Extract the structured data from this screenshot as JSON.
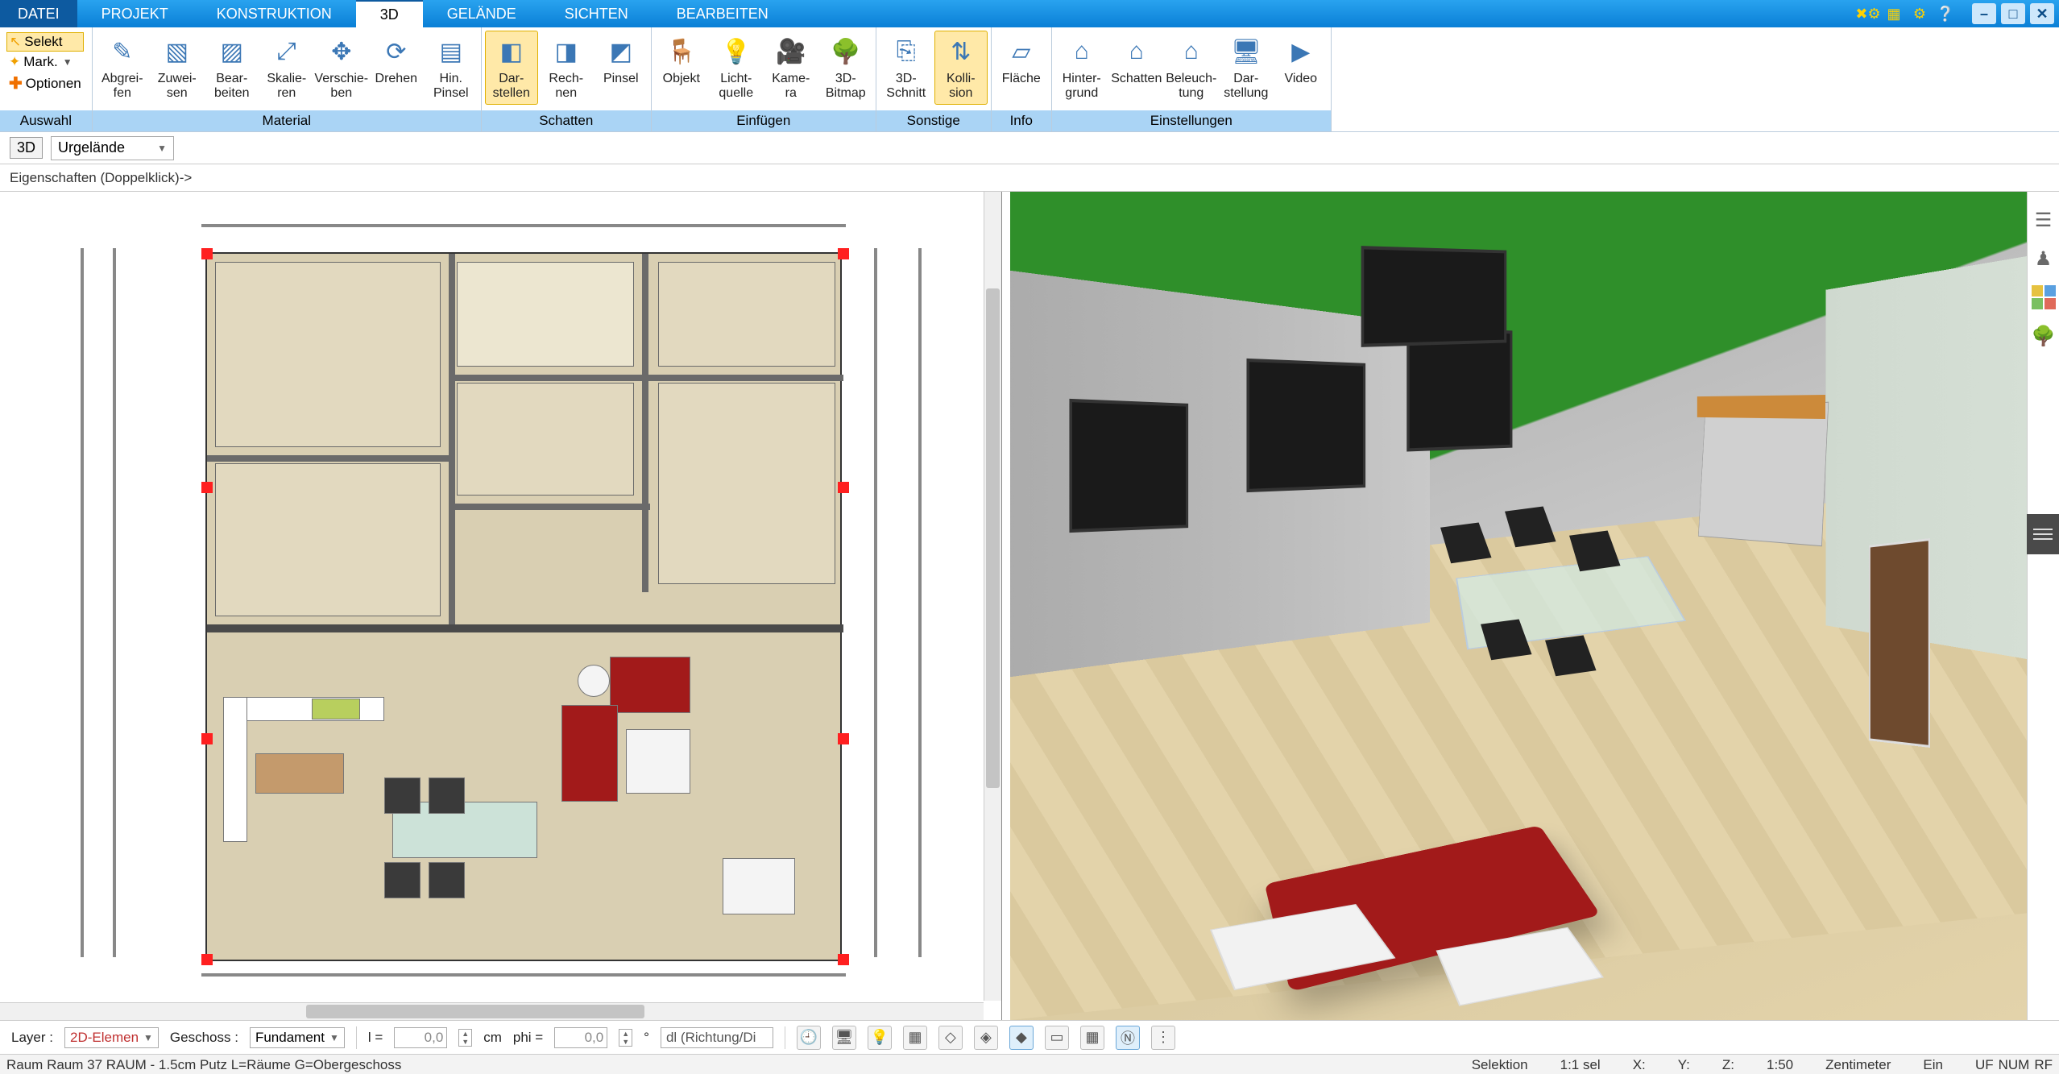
{
  "tabs": {
    "file": "DATEI",
    "projekt": "PROJEKT",
    "konstruktion": "KONSTRUKTION",
    "d3": "3D",
    "gelaende": "GELÄNDE",
    "sichten": "SICHTEN",
    "bearbeiten": "BEARBEITEN"
  },
  "sel": {
    "selekt": "Selekt",
    "mark": "Mark.",
    "optionen": "Optionen",
    "group": "Auswahl"
  },
  "ribbon": {
    "material": {
      "label": "Material",
      "abgreifen": "Abgrei-\nfen",
      "zuweisen": "Zuwei-\nsen",
      "bearbeiten": "Bear-\nbeiten",
      "skalieren": "Skalie-\nren",
      "verschieben": "Verschie-\nben",
      "drehen": "Drehen",
      "hinpinsel": "Hin.\nPinsel"
    },
    "schatten": {
      "label": "Schatten",
      "darstellen": "Dar-\nstellen",
      "rechnen": "Rech-\nnen",
      "pinsel": "Pinsel"
    },
    "einfuegen": {
      "label": "Einfügen",
      "objekt": "Objekt",
      "lichtquelle": "Licht-\nquelle",
      "kamera": "Kame-\nra",
      "bitmap3d": "3D-\nBitmap"
    },
    "sonstige": {
      "label": "Sonstige",
      "schnitt3d": "3D-\nSchnitt",
      "kollision": "Kolli-\nsion"
    },
    "info": {
      "label": "Info",
      "flaeche": "Fläche"
    },
    "einstellungen": {
      "label": "Einstellungen",
      "hintergrund": "Hinter-\ngrund",
      "schatten": "Schatten",
      "beleuchtung": "Beleuch-\ntung",
      "darstellung": "Dar-\nstellung",
      "video": "Video"
    }
  },
  "subbar": {
    "badge": "3D",
    "layer": "Urgelände"
  },
  "propbar": {
    "text": "Eigenschaften (Doppelklick)->"
  },
  "param": {
    "layer_lbl": "Layer :",
    "layer_val": "2D-Elemen",
    "geschoss_lbl": "Geschoss :",
    "geschoss_val": "Fundament",
    "l_lbl": "l =",
    "l_val": "0,0",
    "cm": "cm",
    "phi_lbl": "phi =",
    "phi_val": "0,0",
    "deg": "°",
    "dl_val": "dl (Richtung/Di"
  },
  "status": {
    "left": "Raum Raum 37 RAUM - 1.5cm Putz L=Räume G=Obergeschoss",
    "selektion": "Selektion",
    "sel_ratio": "1:1 sel",
    "x": "X:",
    "y": "Y:",
    "z": "Z:",
    "scale": "1:50",
    "unit": "Zentimeter",
    "ein": "Ein",
    "uf": "UF",
    "num": "NUM",
    "rf": "RF"
  }
}
